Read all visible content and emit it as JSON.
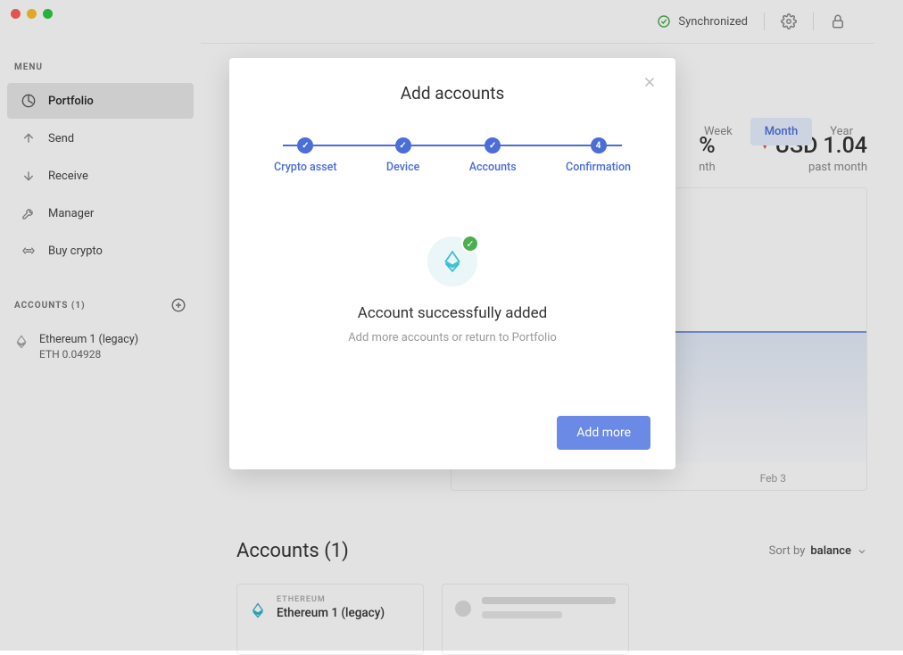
{
  "sidebar": {
    "menu_header": "MENU",
    "items": [
      {
        "label": "Portfolio",
        "icon": "pie-chart-icon",
        "active": true
      },
      {
        "label": "Send",
        "icon": "send-icon"
      },
      {
        "label": "Receive",
        "icon": "receive-icon"
      },
      {
        "label": "Manager",
        "icon": "manager-icon"
      },
      {
        "label": "Buy crypto",
        "icon": "buy-crypto-icon"
      }
    ],
    "accounts_header": "ACCOUNTS (1)",
    "account": {
      "name": "Ethereum 1 (legacy)",
      "balance": "ETH 0.04928"
    }
  },
  "topbar": {
    "sync_label": "Synchronized"
  },
  "stats": {
    "pct_suffix": "%",
    "pct_sub": "nth",
    "usd_prefix": "USD",
    "usd_value": "1.04",
    "usd_sub": "past month"
  },
  "range_tabs": {
    "week": "Week",
    "month": "Month",
    "year": "Year"
  },
  "chart_x": {
    "feb3": "Feb 3"
  },
  "accounts_section": {
    "title": "Accounts (1)",
    "sort_label": "Sort by",
    "sort_value": "balance",
    "card": {
      "chain": "ETHEREUM",
      "name": "Ethereum 1 (legacy)"
    }
  },
  "modal": {
    "title": "Add accounts",
    "steps": {
      "s1": "Crypto asset",
      "s2": "Device",
      "s3": "Accounts",
      "s4": "Confirmation",
      "s4_num": "4"
    },
    "success_title": "Account successfully added",
    "success_sub": "Add more accounts or return to Portfolio",
    "add_more": "Add more"
  }
}
